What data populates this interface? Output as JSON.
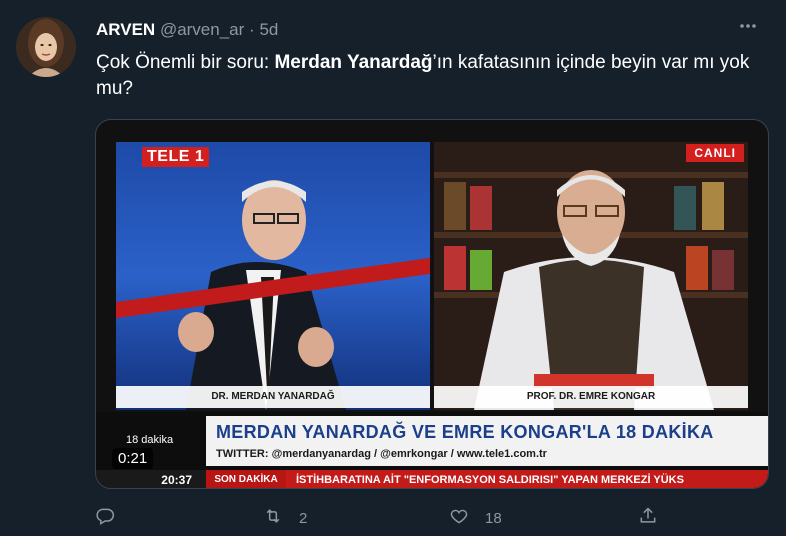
{
  "tweet": {
    "display_name": "ARVEN",
    "handle": "@arven_ar",
    "separator": "·",
    "time": "5d",
    "text_before": "Çok Önemli bir soru: ",
    "text_bold": "Merdan Yanardağ",
    "text_after": "’ın kafatasının içinde beyin var mı yok mu?",
    "more_icon": "more-icon"
  },
  "media": {
    "channel_logo": "TELE 1",
    "live_badge": "CANLI",
    "guest_left_name": "DR. MERDAN YANARDAĞ",
    "guest_right_name": "PROF. DR. EMRE KONGAR",
    "program_tag": "18 dakika",
    "headline": "MERDAN YANARDAĞ VE EMRE KONGAR'LA 18 DAKİKA",
    "twitter_line": "TWITTER: @merdanyanardag / @emrkongar / www.tele1.com.tr",
    "clock": "20:37",
    "ticker_label": "SON DAKİKA",
    "ticker_text": "İSTİHBARATINA AİT \"ENFORMASYON SALDIRISI\" YAPAN MERKEZİ YÜKS",
    "duration": "0:21",
    "brand_red": "#d3201f"
  },
  "actions": {
    "reply_icon": "reply-icon",
    "retweet_icon": "retweet-icon",
    "retweet_count": "2",
    "like_icon": "heart-icon",
    "like_count": "18",
    "share_icon": "share-icon"
  },
  "colors": {
    "background": "#15202b",
    "secondary_text": "#8b98a5"
  }
}
